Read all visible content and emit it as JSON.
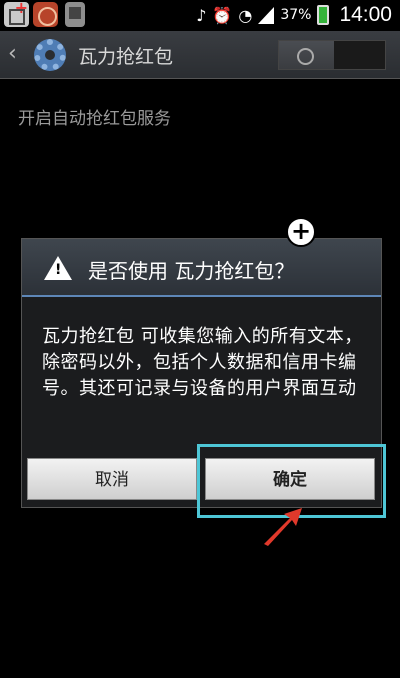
{
  "status_bar": {
    "battery_percent": "37%",
    "time": "14:00"
  },
  "action_bar": {
    "title": "瓦力抢红包"
  },
  "settings": {
    "row_label": "开启自动抢红包服务"
  },
  "dialog": {
    "title": "是否使用 瓦力抢红包？",
    "body": "瓦力抢红包 可收集您输入的所有文本，除密码以外，包括个人数据和信用卡编号。其还可记录与设备的用户界面互动",
    "cancel_label": "取消",
    "ok_label": "确定",
    "plus_symbol": "+",
    "warning_mark": "!"
  },
  "colors": {
    "highlight": "#4ec6d6",
    "arrow": "#e0392b",
    "dialog_divider": "#5e87b8"
  }
}
